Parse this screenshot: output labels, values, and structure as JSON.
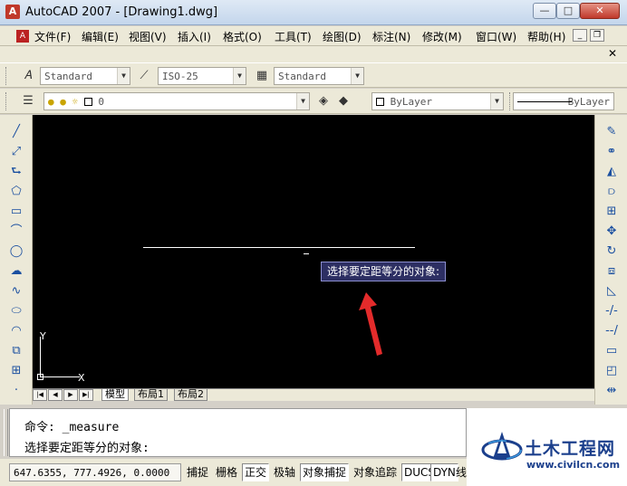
{
  "window": {
    "title": "AutoCAD 2007 - [Drawing1.dwg]",
    "minimize_label": "—",
    "maximize_label": "□",
    "close_label": "✕"
  },
  "menu": [
    "文件(F)",
    "编辑(E)",
    "视图(V)",
    "插入(I)",
    "格式(O)",
    "工具(T)",
    "绘图(D)",
    "标注(N)",
    "修改(M)",
    "窗口(W)",
    "帮助(H)"
  ],
  "styles_toolbar": {
    "text_style": "Standard",
    "dim_style": "ISO-25",
    "table_style": "Standard"
  },
  "layers_toolbar": {
    "current_layer": "0",
    "color": "ByLayer",
    "linetype": "ByLayer"
  },
  "canvas": {
    "tooltip": "选择要定距等分的对象:",
    "ucs_y": "Y",
    "ucs_x": "X"
  },
  "layout_tabs": [
    "模型",
    "布局1",
    "布局2"
  ],
  "command": {
    "line1": "命令: _measure",
    "line2": "选择要定距等分的对象:"
  },
  "status": {
    "coordinates": "647.6355, 777.4926, 0.0000",
    "buttons": [
      {
        "label": "捕捉",
        "on": false
      },
      {
        "label": "栅格",
        "on": false
      },
      {
        "label": "正交",
        "on": true
      },
      {
        "label": "极轴",
        "on": false
      },
      {
        "label": "对象捕捉",
        "on": true
      },
      {
        "label": "对象追踪",
        "on": false
      },
      {
        "label": "DUCS",
        "on": true
      },
      {
        "label": "DYN",
        "on": true
      },
      {
        "label": "线",
        "on": false
      }
    ]
  },
  "watermark": {
    "title": "土木工程网",
    "url": "www.civilcn.com"
  }
}
